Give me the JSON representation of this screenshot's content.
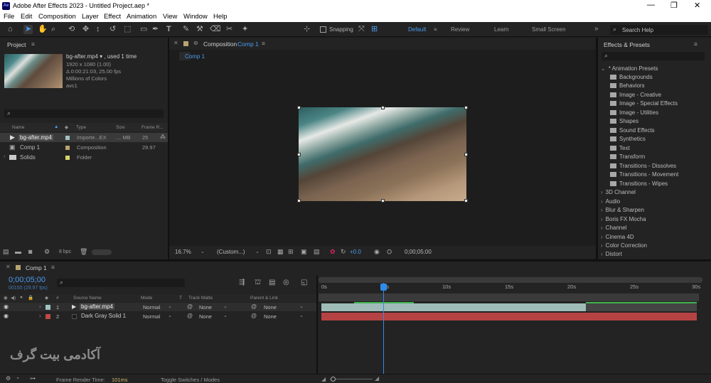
{
  "app": {
    "title": "Adobe After Effects 2023 - Untitled Project.aep *",
    "logo": "Ae"
  },
  "window_controls": {
    "minimize": "—",
    "maximize": "❐",
    "close": "✕"
  },
  "menu": [
    "File",
    "Edit",
    "Composition",
    "Layer",
    "Effect",
    "Animation",
    "View",
    "Window",
    "Help"
  ],
  "toolbar": {
    "snapping": "Snapping",
    "workspaces": [
      "Default",
      "Review",
      "Learn",
      "Small Screen"
    ],
    "search_placeholder": "Search Help",
    "more": "»"
  },
  "project": {
    "title": "Project",
    "menu": "≡",
    "preview": {
      "name": "bg-after.mp4 ▾ , used 1 time",
      "line1": "1920 x 1080 (1.00)",
      "line2": "Δ 0:00:21:03, 25.00 fps",
      "line3": "Millions of Colors",
      "line4": "avc1"
    },
    "search": "⌕",
    "headers": {
      "name": "Name",
      "type": "Type",
      "size": "Size",
      "frame": "Frame R..."
    },
    "items": [
      {
        "name": "bg-after.mp4",
        "type": "Importe...EX",
        "size": "... MB",
        "frame": "25",
        "color": "#9fc3c0"
      },
      {
        "name": "Comp 1",
        "type": "Composition",
        "size": "",
        "frame": "29.97",
        "color": "#b8a470"
      },
      {
        "name": "Solids",
        "type": "Folder",
        "size": "",
        "frame": "",
        "color": "#d9d36a"
      }
    ],
    "bpc": "8 bpc"
  },
  "composition": {
    "title": "Composition",
    "comp_name": "Comp 1",
    "tab": "Comp 1",
    "zoom": "16.7%",
    "resolution": "(Custom...)",
    "exposure": "+0.0",
    "timecode": "0;00;05;00"
  },
  "effects": {
    "title": "Effects & Presets",
    "search": "⌕",
    "presets_root": "* Animation Presets",
    "presets": [
      "Backgrounds",
      "Behaviors",
      "Image - Creative",
      "Image - Special Effects",
      "Image - Utilities",
      "Shapes",
      "Sound Effects",
      "Synthetics",
      "Text",
      "Transform",
      "Transitions - Dissolves",
      "Transitions - Movement",
      "Transitions - Wipes"
    ],
    "categories": [
      "3D Channel",
      "Audio",
      "Blur & Sharpen",
      "Boris FX Mocha",
      "Channel",
      "Cinema 4D",
      "Color Correction",
      "Distort"
    ]
  },
  "timeline": {
    "comp_tab": "Comp 1",
    "timecode": "0;00;05;00",
    "frames": "00150 (29.97 fps)",
    "headers": {
      "num": "#",
      "source": "Source Name",
      "mode": "Mode",
      "t": "T",
      "matte": "Track Matte",
      "parent": "Parent & Link"
    },
    "layers": [
      {
        "num": "1",
        "name": "bg-after.mp4",
        "mode": "Normal",
        "matte": "None",
        "parent": "None",
        "color": "#9fc3c0"
      },
      {
        "num": "2",
        "name": "Dark Gray Solid 1",
        "mode": "Normal",
        "matte": "None",
        "parent": "None",
        "color": "#c04848"
      }
    ],
    "ruler": [
      "0s",
      "05s",
      "10s",
      "15s",
      "20s",
      "25s",
      "30s"
    ],
    "render_time_label": "Frame Render Time:",
    "render_time": "101ms",
    "toggle": "Toggle Switches / Modes"
  },
  "watermark": "آکادمی بیت گرف",
  "colors": {
    "accent": "#2d8ceb",
    "track_green": "#3fb34f",
    "layer1": "#9fc3c0",
    "layer2": "#b54343"
  }
}
